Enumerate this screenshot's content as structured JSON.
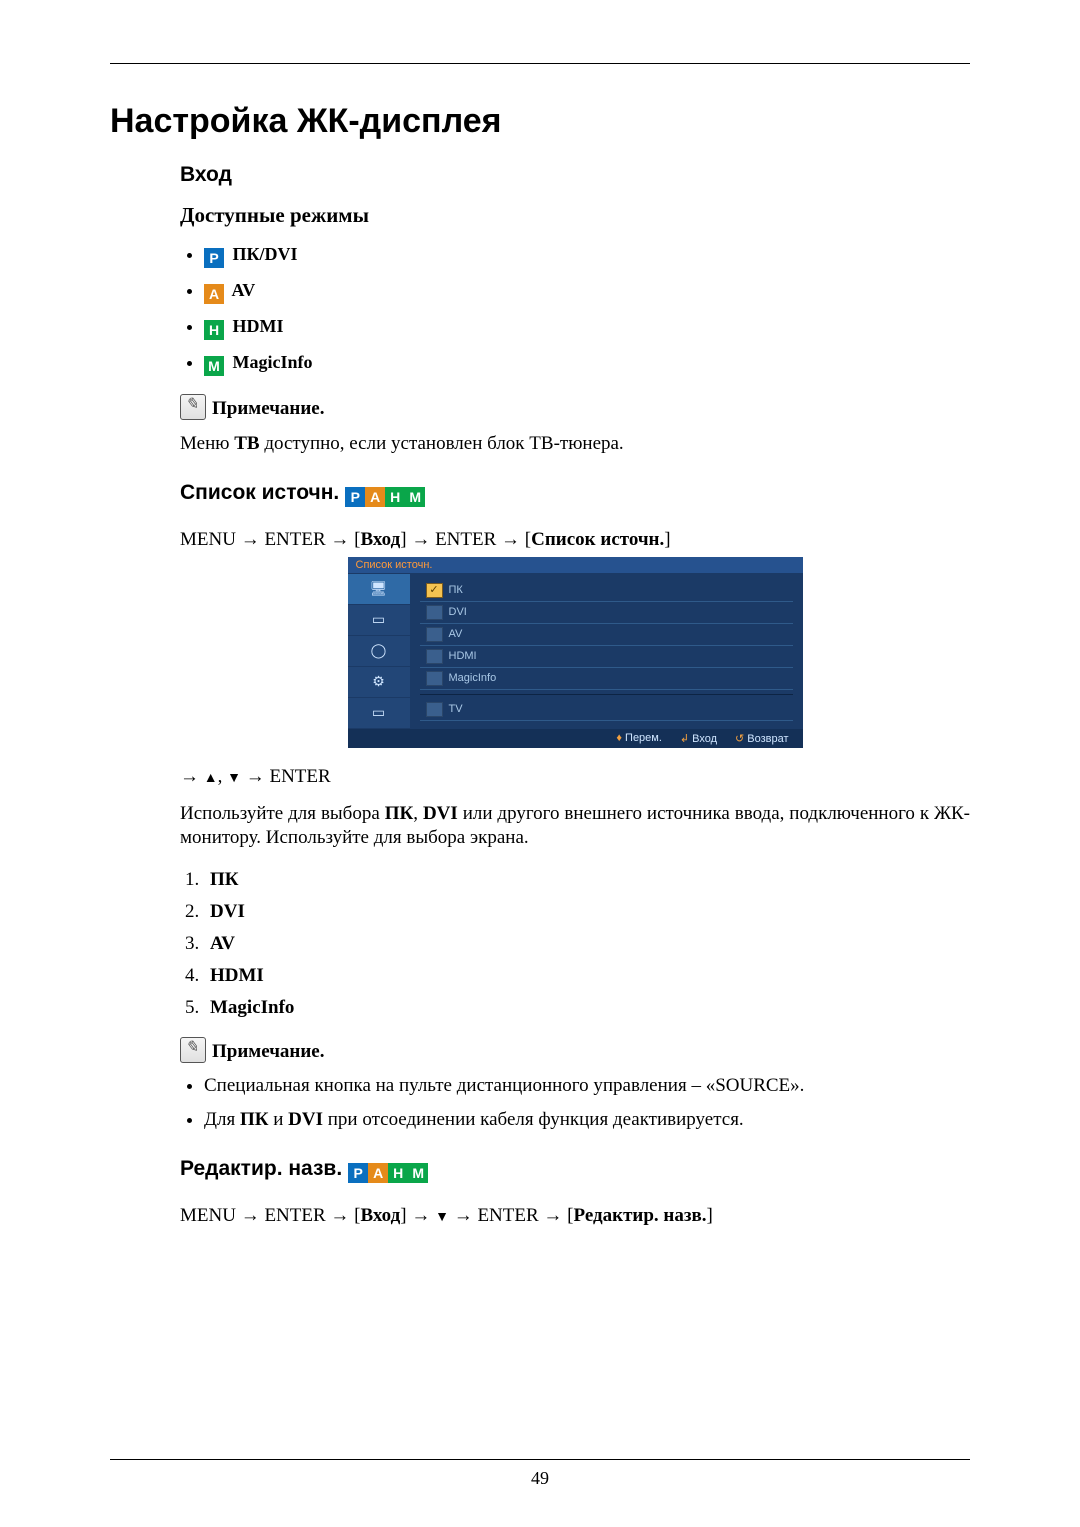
{
  "page_number": "49",
  "main_title": "Настройка ЖК-дисплея",
  "input_section": {
    "title": "Вход",
    "modes_title": "Доступные режимы",
    "modes": [
      {
        "badge": "P",
        "badge_class": "badge-p",
        "label": "ПК/DVI"
      },
      {
        "badge": "A",
        "badge_class": "badge-a",
        "label": "AV"
      },
      {
        "badge": "H",
        "badge_class": "badge-h",
        "label": "HDMI"
      },
      {
        "badge": "M",
        "badge_class": "badge-m",
        "label": "MagicInfo"
      }
    ],
    "note_label": "Примечание.",
    "note_text_prefix": "Меню ",
    "note_text_bold": "TB",
    "note_text_suffix": " доступно, если установлен блок ТВ-тюнера."
  },
  "source_list": {
    "title": "Список источн.",
    "nav_prefix": "MENU → ENTER → [",
    "nav_b1": "Вход",
    "nav_mid": "] → ENTER → [",
    "nav_b2": "Список источн.",
    "nav_suffix": "]",
    "osd": {
      "title": "Список источн.",
      "tabs": [
        "🖥",
        "▭",
        "◯",
        "⚙",
        "▭"
      ],
      "items": [
        {
          "label": "ПК",
          "checked": true
        },
        {
          "label": "DVI",
          "checked": false
        },
        {
          "label": "AV",
          "checked": false
        },
        {
          "label": "HDMI",
          "checked": false
        },
        {
          "label": "MagicInfo",
          "checked": false
        },
        {
          "label": "TV",
          "checked": false,
          "divider_before": true
        }
      ],
      "footer": [
        {
          "icon": "♦",
          "label": "Перем."
        },
        {
          "icon": "↲",
          "label": "Вход"
        },
        {
          "icon": "↺",
          "label": "Возврат"
        }
      ]
    },
    "arrows_row_prefix": "→ ",
    "arrows_row_a": "▲",
    "arrows_row_sep": ", ",
    "arrows_row_b": "▼",
    "arrows_row_suffix": " → ENTER",
    "desc_p1": "Используйте для выбора ",
    "desc_b1": "ПК",
    "desc_p2": ", ",
    "desc_b2": "DVI",
    "desc_p3": " или другого внешнего источника ввода, подключенного к ЖК-монитору. Используйте для выбора экрана.",
    "list": [
      "ПК",
      "DVI",
      "AV",
      "HDMI",
      "MagicInfo"
    ],
    "note_label": "Примечание.",
    "notes": {
      "n1": "Специальная кнопка на пульте дистанционного управления – «SOURCE».",
      "n2_p1": "Для ",
      "n2_b1": "ПК",
      "n2_p2": " и ",
      "n2_b2": "DVI",
      "n2_p3": " при отсоединении кабеля функция деактивируется."
    }
  },
  "edit_name": {
    "title": "Редактир. назв.",
    "nav_prefix": "MENU → ENTER → [",
    "nav_b1": "Вход",
    "nav_mid1": "] → ",
    "nav_tri": "▼",
    "nav_mid2": " → ENTER → [",
    "nav_b2": "Редактир. назв.",
    "nav_suffix": "]"
  }
}
